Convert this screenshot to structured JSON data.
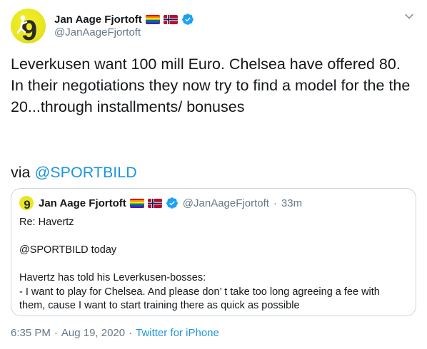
{
  "author": {
    "name": "Jan Aage Fjortoft",
    "handle": "@JanAageFjortoft",
    "avatar_text": "9"
  },
  "tweet": {
    "text": "Leverkusen want 100 mill Euro. Chelsea have offered 80. In their negotiations they now try to find a model for the the 20...through installments/ bonuses",
    "via_label": "via",
    "via_mention": "@SPORTBILD"
  },
  "quote": {
    "name": "Jan Aage Fjortoft",
    "handle": "@JanAageFjortoft",
    "dot": "·",
    "time": "33m",
    "line1": "Re: Havertz",
    "line2": "@SPORTBILD today",
    "line3": "Havertz has told his Leverkusen-bosses:",
    "line4": "- I want to play for Chelsea. And please don’ t take too long agreeing a fee with them, cause I want to start training there as quick as possible"
  },
  "footer": {
    "time": "6:35 PM",
    "dot1": "·",
    "date": "Aug 19, 2020",
    "dot2": "·",
    "source": "Twitter for iPhone"
  },
  "colors": {
    "link": "#1b95e0",
    "secondary_text": "#657786",
    "avatar_bg": "#e8e620",
    "verified": "#1da1f2"
  },
  "icons": [
    "rainbow-flag-icon",
    "norway-flag-icon",
    "verified-badge-icon",
    "chevron-down-icon"
  ]
}
